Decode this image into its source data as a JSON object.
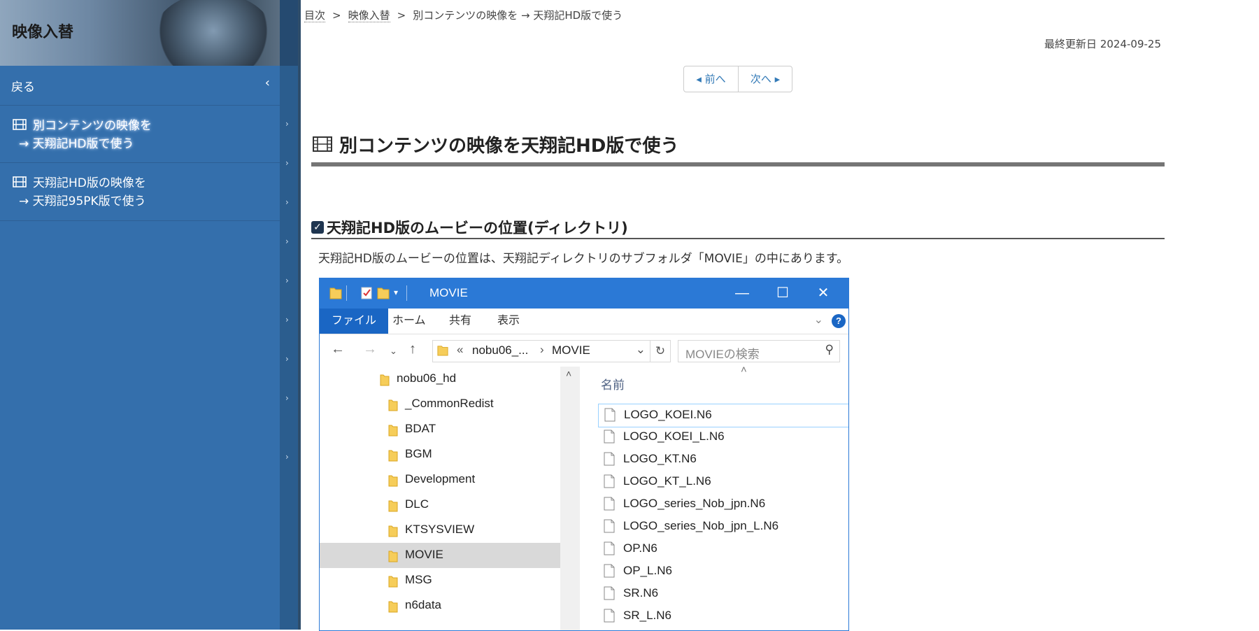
{
  "sidebar": {
    "title": "映像入替",
    "back_label": "戻る",
    "items": [
      {
        "line1": "別コンテンツの映像を",
        "line2": "→ 天翔記HD版で使う"
      },
      {
        "line1": "天翔記HD版の映像を",
        "line2": "→ 天翔記95PK版で使う"
      }
    ]
  },
  "breadcrumb": {
    "items": [
      "目次",
      "映像入替",
      "別コンテンツの映像を",
      "→ 天翔記HD版で使う"
    ],
    "separator": ">"
  },
  "updated": "最終更新日 2024-09-25",
  "pager": {
    "prev": "前へ",
    "next": "次へ"
  },
  "page_title": "別コンテンツの映像を天翔記HD版で使う",
  "section": {
    "title": "天翔記HD版のムービーの位置(ディレクトリ)",
    "description": "天翔記HD版のムービーの位置は、天翔記ディレクトリのサブフォルダ「MOVIE」の中にあります。"
  },
  "explorer": {
    "window_title": "MOVIE",
    "ribbon_tabs": [
      "ファイル",
      "ホーム",
      "共有",
      "表示"
    ],
    "help": "?",
    "address": {
      "overflow": "«",
      "parent": "nobu06_...",
      "current": "MOVIE"
    },
    "search_placeholder": "MOVIEの検索",
    "tree": [
      {
        "name": "nobu06_hd",
        "level": 0,
        "selected": false
      },
      {
        "name": "_CommonRedist",
        "level": 1,
        "selected": false
      },
      {
        "name": "BDAT",
        "level": 1,
        "selected": false
      },
      {
        "name": "BGM",
        "level": 1,
        "selected": false
      },
      {
        "name": "Development",
        "level": 1,
        "selected": false
      },
      {
        "name": "DLC",
        "level": 1,
        "selected": false
      },
      {
        "name": "KTSYSVIEW",
        "level": 1,
        "selected": false
      },
      {
        "name": "MOVIE",
        "level": 1,
        "selected": true
      },
      {
        "name": "MSG",
        "level": 1,
        "selected": false
      },
      {
        "name": "n6data",
        "level": 1,
        "selected": false
      }
    ],
    "column_header": "名前",
    "files": [
      "LOGO_KOEI.N6",
      "LOGO_KOEI_L.N6",
      "LOGO_KT.N6",
      "LOGO_KT_L.N6",
      "LOGO_series_Nob_jpn.N6",
      "LOGO_series_Nob_jpn_L.N6",
      "OP.N6",
      "OP_L.N6",
      "SR.N6",
      "SR_L.N6"
    ]
  },
  "colors": {
    "sidebar": "#346fac",
    "accent": "#2b79d6",
    "link": "#337ab7"
  }
}
